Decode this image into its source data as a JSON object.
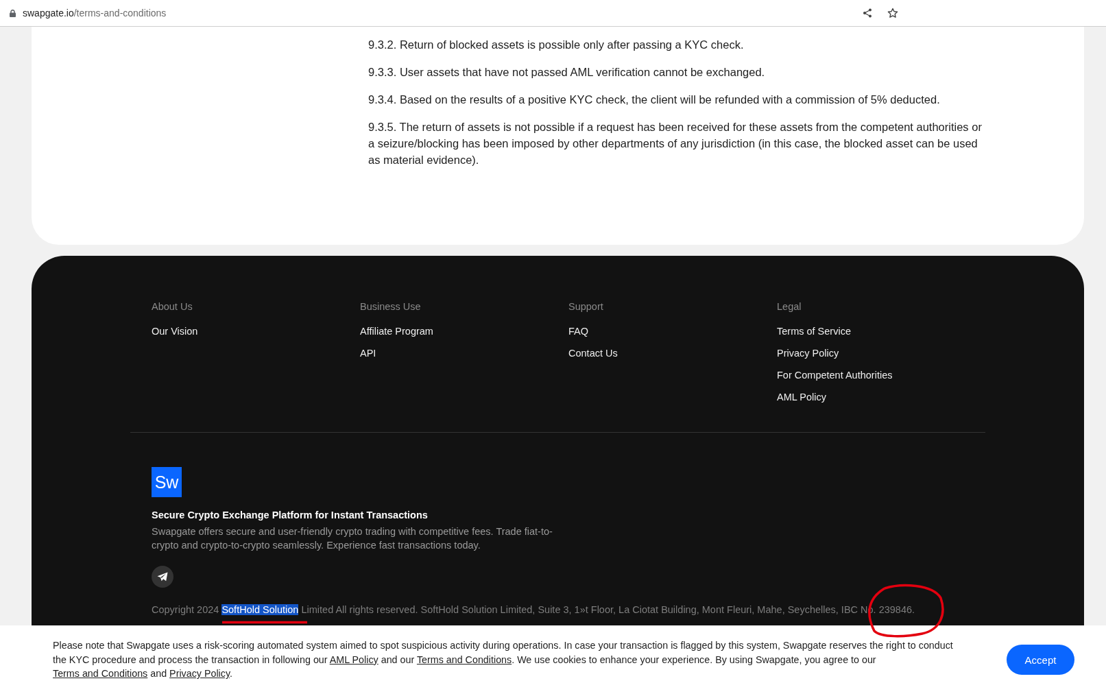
{
  "browser": {
    "host": "swapgate.io",
    "path": "/terms-and-conditions"
  },
  "terms": [
    {
      "number": "9.3.2.",
      "text": "Return of blocked assets is possible only after passing a KYC check."
    },
    {
      "number": "9.3.3.",
      "text": "User assets that have not passed AML verification cannot be exchanged."
    },
    {
      "number": "9.3.4.",
      "text": "Based on the results of a positive KYC check, the client will be refunded with a commission of 5% deducted."
    },
    {
      "number": "9.3.5.",
      "text": "The return of assets is not possible if a request has been received for these assets from the competent authorities or a seizure/blocking has been imposed by other departments of any jurisdiction (in this case, the blocked asset can be used as material evidence)."
    }
  ],
  "footer": {
    "columns": [
      {
        "heading": "About Us",
        "links": [
          "Our Vision"
        ]
      },
      {
        "heading": "Business Use",
        "links": [
          "Affiliate Program",
          "API"
        ]
      },
      {
        "heading": "Support",
        "links": [
          "FAQ",
          "Contact Us"
        ]
      },
      {
        "heading": "Legal",
        "links": [
          "Terms of Service",
          "Privacy Policy",
          "For Competent Authorities",
          "AML Policy"
        ]
      }
    ],
    "brand": {
      "logo": "Sw",
      "title": "Secure Crypto Exchange Platform for Instant Transactions",
      "description": "Swapgate offers secure and user-friendly crypto trading with competitive fees. Trade fiat-to-crypto and crypto-to-crypto seamlessly. Experience fast transactions today."
    },
    "copyright": [
      {
        "text": "Copyright 2024 ",
        "selected": false
      },
      {
        "text": "SoftHold Solution",
        "selected": true
      },
      {
        "text": " Limited All rights reserved. SoftHold Solution Limited, Suite 3, 1»t Floor, La Ciotat Building, Mont Fleuri, Mahe, Seychelles, IBC No. 239846.",
        "selected": false
      }
    ]
  },
  "annotations": {
    "underline": true,
    "circle": true
  },
  "cookie_banner": {
    "parts": [
      {
        "kind": "text",
        "text": "Please note that Swapgate uses a risk-scoring automated system aimed to spot suspicious activity during operations. In case your transaction is flagged by this system, Swapgate reserves the right to conduct the KYC procedure and process the transaction in following our "
      },
      {
        "kind": "link",
        "text": "AML Policy"
      },
      {
        "kind": "text",
        "text": " and our "
      },
      {
        "kind": "link",
        "text": "Terms and Conditions"
      },
      {
        "kind": "text",
        "text": ". We use cookies to enhance your experience. By using Swapgate, you agree to our "
      },
      {
        "kind": "link",
        "text": "Terms and Conditions"
      },
      {
        "kind": "text",
        "text": " and "
      },
      {
        "kind": "link",
        "text": "Privacy Policy"
      },
      {
        "kind": "text",
        "text": "."
      }
    ],
    "button": "Accept"
  }
}
